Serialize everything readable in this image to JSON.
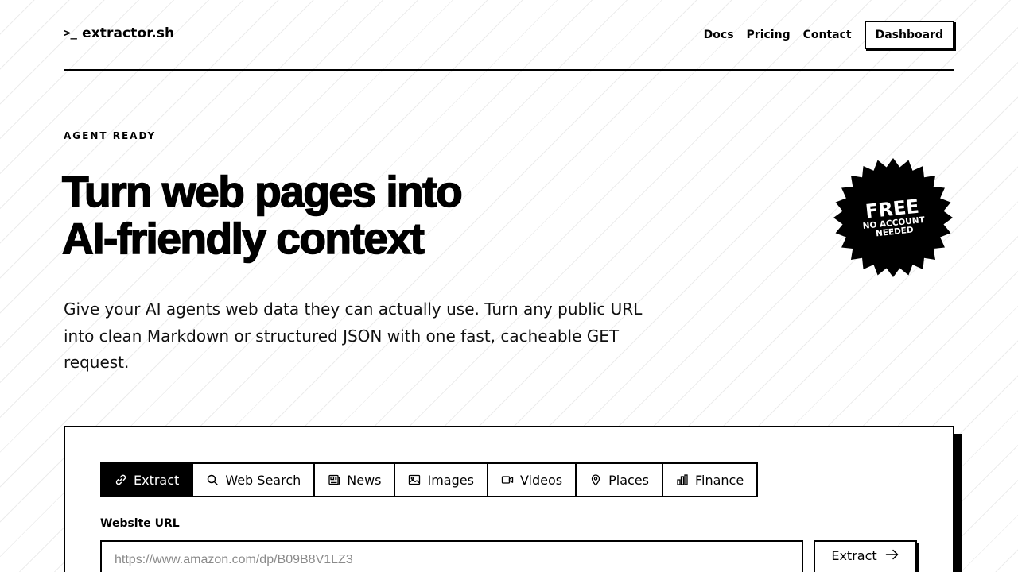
{
  "header": {
    "logo_mark": ">_",
    "logo_text": "extractor.sh",
    "nav": [
      {
        "label": "Docs"
      },
      {
        "label": "Pricing"
      },
      {
        "label": "Contact"
      }
    ],
    "dashboard_label": "Dashboard"
  },
  "hero": {
    "eyebrow": "AGENT READY",
    "headline_line1": "Turn web pages into",
    "headline_line2": "AI-friendly context",
    "subtitle": "Give your AI agents web data they can actually use. Turn any public URL into clean Markdown or structured JSON with one fast, cacheable GET request."
  },
  "badge": {
    "main": "FREE",
    "sub": "NO ACCOUNT NEEDED"
  },
  "tool": {
    "tabs": [
      {
        "label": "Extract",
        "icon": "link-icon",
        "active": true
      },
      {
        "label": "Web Search",
        "icon": "search-icon",
        "active": false
      },
      {
        "label": "News",
        "icon": "newspaper-icon",
        "active": false
      },
      {
        "label": "Images",
        "icon": "image-icon",
        "active": false
      },
      {
        "label": "Videos",
        "icon": "video-icon",
        "active": false
      },
      {
        "label": "Places",
        "icon": "map-pin-icon",
        "active": false
      },
      {
        "label": "Finance",
        "icon": "bar-chart-icon",
        "active": false
      }
    ],
    "field_label": "Website URL",
    "url_placeholder": "https://www.amazon.com/dp/B09B8V1LZ3",
    "url_value": "",
    "submit_label": "Extract",
    "submit_icon": "arrow-right-icon"
  },
  "colors": {
    "text": "#000000",
    "background": "#ffffff",
    "placeholder": "#8a8a8a"
  }
}
